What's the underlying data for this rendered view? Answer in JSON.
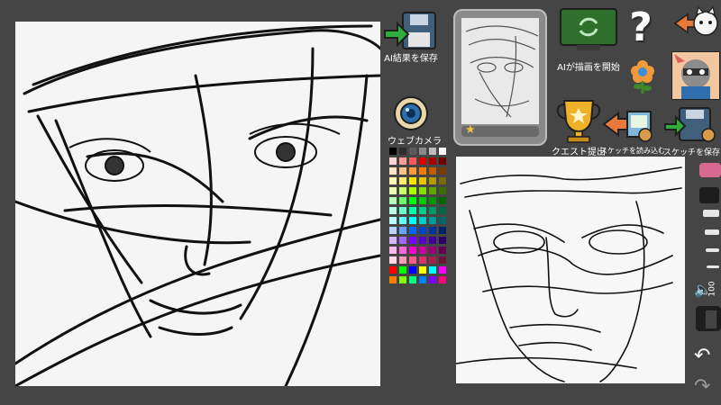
{
  "toolbar": {
    "save_ai_label": "AI結果を保存",
    "ai_draw_label": "AIが描画を開始",
    "webcam_label": "ウェブカメラ",
    "quest_label": "クエスト提出",
    "load_sketch_label": "スケッチを読み込む",
    "save_sketch_label": "スケッチを保存",
    "help_glyph": "?",
    "volume_value": "100"
  },
  "colors": {
    "background": "#454545",
    "accent": "#d86a92",
    "monitor": "#2e6f2b",
    "trophy": "#f0b12a"
  },
  "palette_colors": [
    "#000000",
    "#2e2e2e",
    "#5a5a5a",
    "#8a8a8a",
    "#bcbcbc",
    "#ffffff",
    "#ffd6d6",
    "#ff9b9b",
    "#ff5a5a",
    "#e00000",
    "#a40000",
    "#6d0000",
    "#ffe6c9",
    "#ffc18a",
    "#ff9a3c",
    "#ff7a00",
    "#c25b00",
    "#7a3a00",
    "#fff6b8",
    "#ffee66",
    "#ffe400",
    "#e6c500",
    "#b39800",
    "#7a6800",
    "#eaffb3",
    "#ccff66",
    "#aaff00",
    "#88dd00",
    "#5fa600",
    "#3b6d00",
    "#b8ffb8",
    "#66ff66",
    "#00ff00",
    "#00cc00",
    "#009900",
    "#006600",
    "#b8ffe6",
    "#66ffcc",
    "#00ffaa",
    "#00cc88",
    "#009966",
    "#006644",
    "#b8ffff",
    "#66ffff",
    "#00ffff",
    "#00cccc",
    "#009999",
    "#006666",
    "#b8d6ff",
    "#66a3ff",
    "#0066ff",
    "#0044cc",
    "#003399",
    "#002266",
    "#d6b8ff",
    "#a366ff",
    "#7a00ff",
    "#5a00cc",
    "#3f0099",
    "#2a0066",
    "#ffb8f0",
    "#ff66dd",
    "#ff00cc",
    "#cc00a3",
    "#99007a",
    "#660052",
    "#ffd9e6",
    "#ff99bb",
    "#ff5c8a",
    "#e0306a",
    "#a8204e",
    "#6d1333",
    "#ff0000",
    "#00ff00",
    "#0000ff",
    "#ffff00",
    "#00ffff",
    "#ff00ff",
    "#ff8000",
    "#80ff00",
    "#00ff80",
    "#0080ff",
    "#8000ff",
    "#ff0080"
  ],
  "brush_sizes_count": 5
}
